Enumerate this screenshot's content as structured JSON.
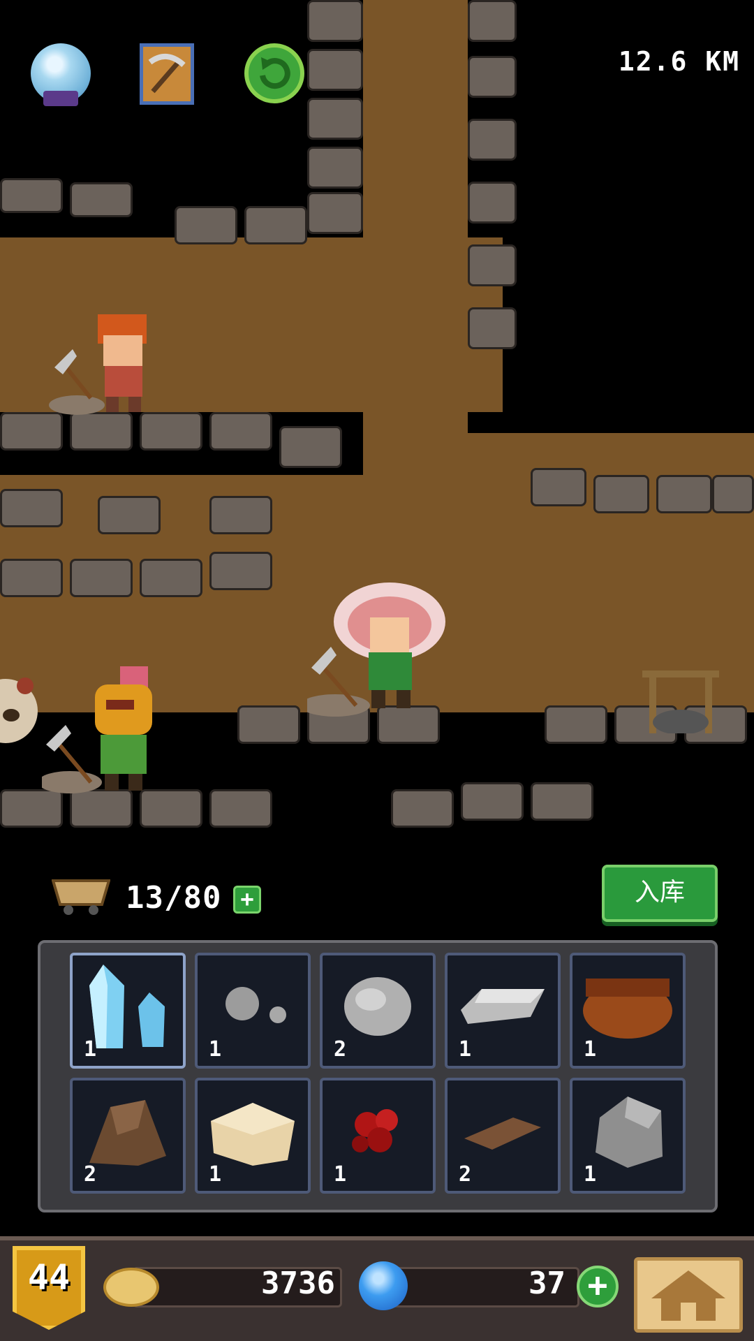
{
  "hud": {
    "distance": "12.6 KM",
    "icons": [
      "crystal-ball-icon",
      "pickaxe-book-icon",
      "refresh-icon"
    ]
  },
  "cart": {
    "count": "13/80",
    "plus": "+",
    "store_label": "入库"
  },
  "inventory": [
    {
      "icon": "blue-crystal-icon",
      "count": "1",
      "selected": true
    },
    {
      "icon": "small-stones-icon",
      "count": "1"
    },
    {
      "icon": "silver-ore-icon",
      "count": "2"
    },
    {
      "icon": "iron-ingot-icon",
      "count": "1"
    },
    {
      "icon": "leather-pouch-icon",
      "count": "1"
    },
    {
      "icon": "brown-rock-icon",
      "count": "2"
    },
    {
      "icon": "sandstone-block-icon",
      "count": "1"
    },
    {
      "icon": "red-berries-icon",
      "count": "1"
    },
    {
      "icon": "wood-plank-icon",
      "count": "2"
    },
    {
      "icon": "grey-stone-icon",
      "count": "1"
    }
  ],
  "bottom": {
    "level": "44",
    "gold": "3736",
    "gems": "37",
    "gem_plus": "+"
  }
}
